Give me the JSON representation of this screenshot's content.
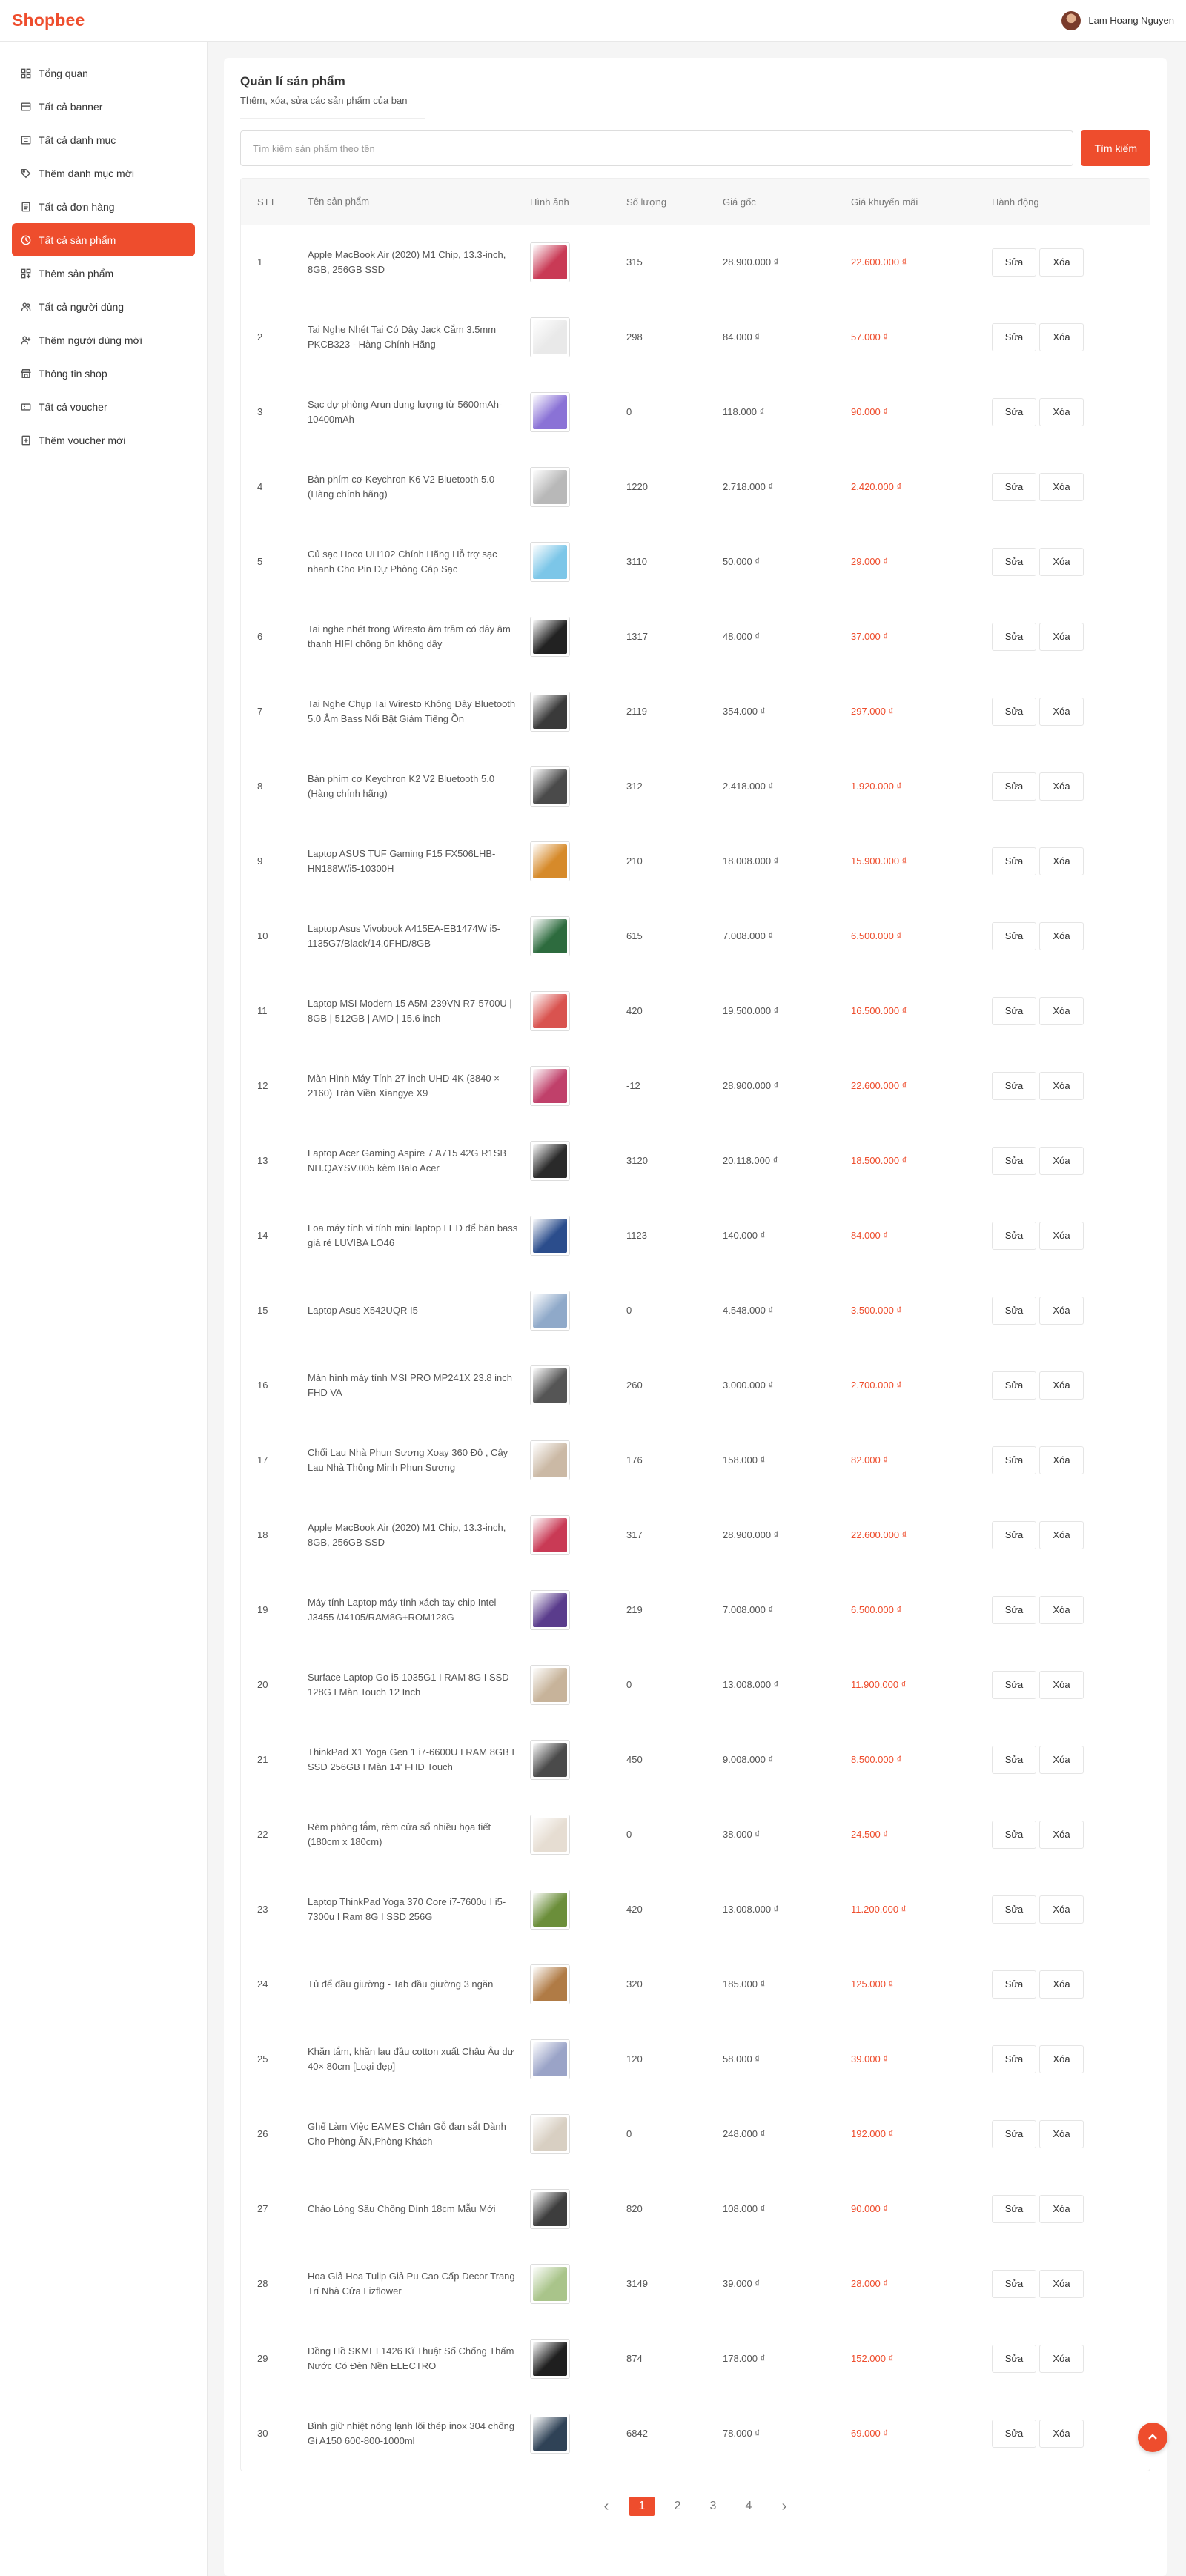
{
  "app": {
    "logo": "Shopbee",
    "user_name": "Lam Hoang Nguyen"
  },
  "sidebar": {
    "items": [
      {
        "label": "Tổng quan",
        "icon": "dashboard-icon"
      },
      {
        "label": "Tất cả banner",
        "icon": "banner-icon"
      },
      {
        "label": "Tất cả danh mục",
        "icon": "category-icon"
      },
      {
        "label": "Thêm danh mục mới",
        "icon": "tag-icon"
      },
      {
        "label": "Tất cả đơn hàng",
        "icon": "order-icon"
      },
      {
        "label": "Tất cả sản phẩm",
        "icon": "product-icon",
        "active": true
      },
      {
        "label": "Thêm sản phẩm",
        "icon": "add-product-icon"
      },
      {
        "label": "Tất cả người dùng",
        "icon": "users-icon"
      },
      {
        "label": "Thêm người dùng mới",
        "icon": "add-user-icon"
      },
      {
        "label": "Thông tin shop",
        "icon": "shop-icon"
      },
      {
        "label": "Tất cả voucher",
        "icon": "voucher-icon"
      },
      {
        "label": "Thêm voucher mới",
        "icon": "add-voucher-icon"
      }
    ]
  },
  "page": {
    "title": "Quản lí sản phẩm",
    "subtitle": "Thêm, xóa, sửa các sản phẩm của bạn"
  },
  "search": {
    "placeholder": "Tìm kiếm sản phẩm theo tên",
    "button": "Tìm kiếm"
  },
  "table": {
    "headers": [
      "STT",
      "Tên sản phẩm",
      "Hình ảnh",
      "Số lượng",
      "Giá gốc",
      "Giá khuyến mãi",
      "Hành động"
    ],
    "edit_label": "Sửa",
    "delete_label": "Xóa",
    "rows": [
      {
        "stt": "1",
        "name": "Apple MacBook Air (2020) M1 Chip, 13.3-inch, 8GB, 256GB SSD",
        "qty": "315",
        "price": "28.900.000 ₫",
        "sale": "22.600.000 ₫",
        "thumb": "#c93a55"
      },
      {
        "stt": "2",
        "name": "Tai Nghe Nhét Tai Có Dây Jack Cắm 3.5mm PKCB323 - Hàng Chính Hãng",
        "qty": "298",
        "price": "84.000 ₫",
        "sale": "57.000 ₫",
        "thumb": "#e9e9e9"
      },
      {
        "stt": "3",
        "name": "Sạc dự phòng Arun dung lượng từ 5600mAh-10400mAh",
        "qty": "0",
        "price": "118.000 ₫",
        "sale": "90.000 ₫",
        "thumb": "#8a72d6"
      },
      {
        "stt": "4",
        "name": "Bàn phím cơ Keychron K6 V2 Bluetooth 5.0 (Hàng chính hãng)",
        "qty": "1220",
        "price": "2.718.000 ₫",
        "sale": "2.420.000 ₫",
        "thumb": "#b8b8b8"
      },
      {
        "stt": "5",
        "name": "Củ sạc Hoco UH102 Chính Hãng Hỗ trợ sạc nhanh Cho Pin Dự Phòng Cáp Sạc",
        "qty": "3110",
        "price": "50.000 ₫",
        "sale": "29.000 ₫",
        "thumb": "#7cc6e8"
      },
      {
        "stt": "6",
        "name": "Tai nghe nhét trong Wiresto âm trầm có dây âm thanh HIFI chống ồn không dây",
        "qty": "1317",
        "price": "48.000 ₫",
        "sale": "37.000 ₫",
        "thumb": "#222222"
      },
      {
        "stt": "7",
        "name": "Tai Nghe Chụp Tai Wiresto Không Dây Bluetooth 5.0 Âm Bass Nổi Bật Giảm Tiếng Ồn",
        "qty": "2119",
        "price": "354.000 ₫",
        "sale": "297.000 ₫",
        "thumb": "#3a3a3a"
      },
      {
        "stt": "8",
        "name": "Bàn phím cơ Keychron K2 V2 Bluetooth 5.0 (Hàng chính hãng)",
        "qty": "312",
        "price": "2.418.000 ₫",
        "sale": "1.920.000 ₫",
        "thumb": "#4a4a4a"
      },
      {
        "stt": "9",
        "name": "Laptop ASUS TUF Gaming F15 FX506LHB-HN188W/i5-10300H",
        "qty": "210",
        "price": "18.008.000 ₫",
        "sale": "15.900.000 ₫",
        "thumb": "#d68a2a"
      },
      {
        "stt": "10",
        "name": "Laptop Asus Vivobook A415EA-EB1474W i5-1135G7/Black/14.0FHD/8GB",
        "qty": "615",
        "price": "7.008.000 ₫",
        "sale": "6.500.000 ₫",
        "thumb": "#2d6b3e"
      },
      {
        "stt": "11",
        "name": "Laptop MSI Modern 15 A5M-239VN R7-5700U | 8GB | 512GB | AMD | 15.6 inch",
        "qty": "420",
        "price": "19.500.000 ₫",
        "sale": "16.500.000 ₫",
        "thumb": "#d9534f"
      },
      {
        "stt": "12",
        "name": "Màn Hình Máy Tính 27 inch UHD 4K (3840 × 2160) Tràn Viền Xiangye X9",
        "qty": "-12",
        "price": "28.900.000 ₫",
        "sale": "22.600.000 ₫",
        "thumb": "#c0406a"
      },
      {
        "stt": "13",
        "name": "Laptop Acer Gaming Aspire 7 A715 42G R1SB NH.QAYSV.005 kèm Balo Acer",
        "qty": "3120",
        "price": "20.118.000 ₫",
        "sale": "18.500.000 ₫",
        "thumb": "#2a2a2a"
      },
      {
        "stt": "14",
        "name": "Loa máy tính vi tính mini laptop LED để bàn bass giá rẻ LUVIBA LO46",
        "qty": "1123",
        "price": "140.000 ₫",
        "sale": "84.000 ₫",
        "thumb": "#2b4d8c"
      },
      {
        "stt": "15",
        "name": "Laptop Asus X542UQR I5",
        "qty": "0",
        "price": "4.548.000 ₫",
        "sale": "3.500.000 ₫",
        "thumb": "#8fa9c9"
      },
      {
        "stt": "16",
        "name": "Màn hình máy tính MSI PRO MP241X 23.8 inch FHD VA",
        "qty": "260",
        "price": "3.000.000 ₫",
        "sale": "2.700.000 ₫",
        "thumb": "#555555"
      },
      {
        "stt": "17",
        "name": "Chổi Lau Nhà Phun Sương Xoay 360 Độ , Cây Lau Nhà Thông Minh Phun Sương",
        "qty": "176",
        "price": "158.000 ₫",
        "sale": "82.000 ₫",
        "thumb": "#cbb9a5"
      },
      {
        "stt": "18",
        "name": "Apple MacBook Air (2020) M1 Chip, 13.3-inch, 8GB, 256GB SSD",
        "qty": "317",
        "price": "28.900.000 ₫",
        "sale": "22.600.000 ₫",
        "thumb": "#c93a55"
      },
      {
        "stt": "19",
        "name": "Máy tính Laptop máy tính xách tay chip Intel J3455 /J4105/RAM8G+ROM128G",
        "qty": "219",
        "price": "7.008.000 ₫",
        "sale": "6.500.000 ₫",
        "thumb": "#5a3c8c"
      },
      {
        "stt": "20",
        "name": "Surface Laptop Go i5-1035G1 I RAM 8G I SSD 128G I Màn Touch 12 Inch",
        "qty": "0",
        "price": "13.008.000 ₫",
        "sale": "11.900.000 ₫",
        "thumb": "#c7b39a"
      },
      {
        "stt": "21",
        "name": "ThinkPad X1 Yoga Gen 1 i7-6600U I RAM 8GB I SSD 256GB I Màn 14' FHD Touch",
        "qty": "450",
        "price": "9.008.000 ₫",
        "sale": "8.500.000 ₫",
        "thumb": "#4a4a4a"
      },
      {
        "stt": "22",
        "name": "Rèm phòng tắm, rèm cửa sổ nhiều họa tiết (180cm x 180cm)",
        "qty": "0",
        "price": "38.000 ₫",
        "sale": "24.500 ₫",
        "thumb": "#e6ddd2"
      },
      {
        "stt": "23",
        "name": "Laptop ThinkPad Yoga 370 Core i7-7600u I i5-7300u I Ram 8G I SSD 256G",
        "qty": "420",
        "price": "13.008.000 ₫",
        "sale": "11.200.000 ₫",
        "thumb": "#6b8e3a"
      },
      {
        "stt": "24",
        "name": "Tủ để đầu giường - Tab đầu giường 3 ngăn",
        "qty": "320",
        "price": "185.000 ₫",
        "sale": "125.000 ₫",
        "thumb": "#b07b45"
      },
      {
        "stt": "25",
        "name": "Khăn tắm, khăn lau đầu cotton xuất Châu Âu dư 40× 80cm [Loại đẹp]",
        "qty": "120",
        "price": "58.000 ₫",
        "sale": "39.000 ₫",
        "thumb": "#9aa3c7"
      },
      {
        "stt": "26",
        "name": "Ghế Làm Việc EAMES Chân Gỗ đan sắt Dành Cho Phòng ĂN,Phòng Khách",
        "qty": "0",
        "price": "248.000 ₫",
        "sale": "192.000 ₫",
        "thumb": "#d8cfc2"
      },
      {
        "stt": "27",
        "name": "Chảo Lòng Sâu Chống Dính 18cm Mẫu Mới",
        "qty": "820",
        "price": "108.000 ₫",
        "sale": "90.000 ₫",
        "thumb": "#3d3d3d"
      },
      {
        "stt": "28",
        "name": "Hoa Giả Hoa Tulip Giả Pu Cao Cấp Decor Trang Trí Nhà Cửa Lizflower",
        "qty": "3149",
        "price": "39.000 ₫",
        "sale": "28.000 ₫",
        "thumb": "#a9c48a"
      },
      {
        "stt": "29",
        "name": "Đồng Hồ SKMEI 1426 Kĩ Thuật Số Chống Thấm Nước Có Đèn Nền ELECTRO",
        "qty": "874",
        "price": "178.000 ₫",
        "sale": "152.000 ₫",
        "thumb": "#1f1f1f"
      },
      {
        "stt": "30",
        "name": "Bình giữ nhiệt nóng lạnh lõi thép inox 304 chống Gỉ A150 600-800-1000ml",
        "qty": "6842",
        "price": "78.000 ₫",
        "sale": "69.000 ₫",
        "thumb": "#2f4256"
      }
    ]
  },
  "pagination": {
    "pages": [
      "1",
      "2",
      "3",
      "4"
    ],
    "active": "1",
    "prev": "‹",
    "next": "›"
  },
  "colors": {
    "accent": "#ee4d2d"
  }
}
